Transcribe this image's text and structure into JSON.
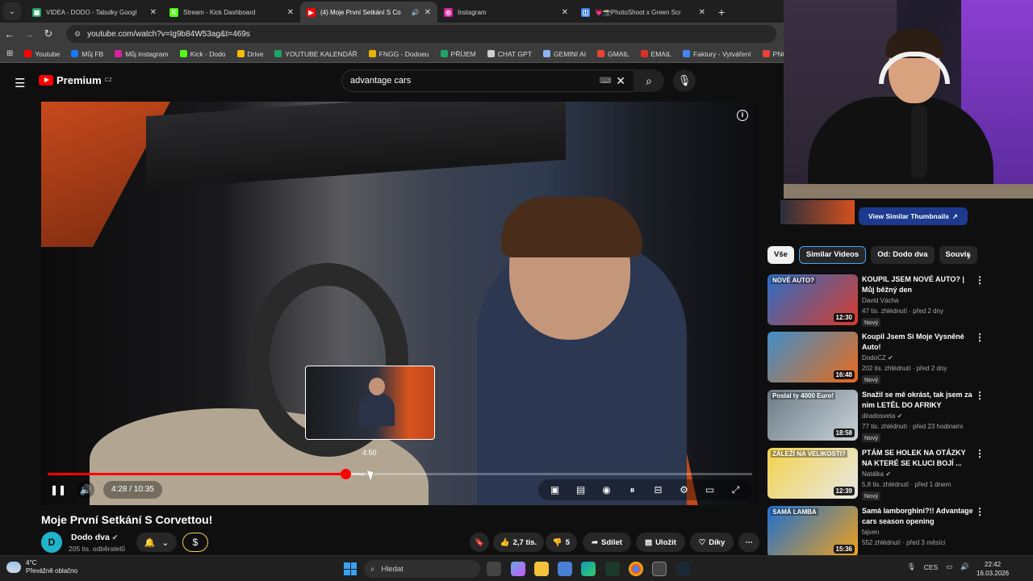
{
  "browser": {
    "tabs": [
      {
        "title": "VIDEA - DODO - Tabulky Googl",
        "fav_color": "#1fa463",
        "fav_glyph": "▦",
        "active": false,
        "audio": false
      },
      {
        "title": "Stream - Kick Dashboard",
        "fav_color": "#53fc18",
        "fav_glyph": "K",
        "active": false,
        "audio": false
      },
      {
        "title": "(4) Moje První Setkání S Co",
        "fav_color": "#ff0000",
        "fav_glyph": "▶",
        "active": true,
        "audio": true
      },
      {
        "title": "Instagram",
        "fav_color": "#d6249f",
        "fav_glyph": "◎",
        "active": false,
        "audio": false
      },
      {
        "title": "💗📸PhotoShoot x Green Scr",
        "fav_color": "#4285f4",
        "fav_glyph": "◫",
        "active": false,
        "audio": false
      }
    ],
    "new_tab": "+",
    "url": "youtube.com/watch?v=Ig9b84W53ag&t=469s",
    "bookmarks": [
      {
        "label": "Youtube",
        "color": "#ff0000"
      },
      {
        "label": "Můj FB",
        "color": "#1877f2"
      },
      {
        "label": "Můj instagram",
        "color": "#d6249f"
      },
      {
        "label": "Kick - Dodo",
        "color": "#53fc18"
      },
      {
        "label": "Drive",
        "color": "#fbbc04"
      },
      {
        "label": "YOUTUBE KALENDÁŘ",
        "color": "#1fa463"
      },
      {
        "label": "FNGG - Dodoeu",
        "color": "#e8b100"
      },
      {
        "label": "PŘÍJEM",
        "color": "#1fa463"
      },
      {
        "label": "CHAT GPT",
        "color": "#cccccc"
      },
      {
        "label": "GEMINI AI",
        "color": "#8ab4f8"
      },
      {
        "label": "GMAIL",
        "color": "#ea4335"
      },
      {
        "label": "EMAIL",
        "color": "#d93025"
      },
      {
        "label": "Faktury - Vytváření",
        "color": "#4285f4"
      },
      {
        "label": "PNG to PDF",
        "color": "#e94235"
      },
      {
        "label": "S",
        "color": "#444444"
      }
    ]
  },
  "youtube": {
    "logo_text": "Premium",
    "logo_region": "CZ",
    "search_value": "advantage cars",
    "video": {
      "title": "Moje První Setkání S Corvettou!",
      "current_time": "4:28",
      "duration": "10:35",
      "time_display": "4:28 / 10:35",
      "played_fraction": 0.423,
      "buffered_fraction": 0.45,
      "preview_time": "4:50"
    },
    "channel": {
      "name": "Dodo dva",
      "subscribers": "205 tis. odběratelů",
      "avatar_glyph": "D"
    },
    "actions": {
      "likes": "2,7 tis.",
      "dislikes": "5",
      "share": "Sdílet",
      "save": "Uložit",
      "thanks": "Díky"
    },
    "view_similar": "View Similar Thumbnails",
    "chips": [
      "Vše",
      "Similar Videos",
      "Od: Dodo dva",
      "Souvis"
    ],
    "recommendations": [
      {
        "title": "KOUPIL JSEM NOVÉ AUTO? | Můj běžný den",
        "channel": "David Vácha",
        "verified": false,
        "meta": "47 tis. zhlédnutí · před 2 dny",
        "badge": "Nový",
        "duration": "12:30",
        "thumb_text": "NOVÉ AUTO?",
        "colors": [
          "#2a6fc7",
          "#d83a2a"
        ]
      },
      {
        "title": "Koupil Jsem Si Moje Vysněné Auto!",
        "channel": "DodoCZ",
        "verified": true,
        "meta": "202 tis. zhlédnutí · před 2 dny",
        "badge": "Nový",
        "duration": "16:48",
        "thumb_text": "",
        "colors": [
          "#3f8fc9",
          "#e86a1a"
        ]
      },
      {
        "title": "Snažil se mě okrást, tak jsem za ním LETĚL DO AFRIKY",
        "channel": "diradosveta",
        "verified": true,
        "meta": "77 tis. zhlédnutí · před 23 hodinami",
        "badge": "Nový",
        "duration": "18:58",
        "thumb_text": "Poslal ty 4000 Euro!",
        "colors": [
          "#6a7a86",
          "#c9d2d8"
        ]
      },
      {
        "title": "PTÁM SE HOLEK NA OTÁZKY NA KTERÉ SE KLUCI BOJÍ ...",
        "channel": "Natálka",
        "verified": true,
        "meta": "5,8 tis. zhlédnutí · před 1 dnem",
        "badge": "Nový",
        "duration": "12:39",
        "thumb_text": "ZÁLEŽÍ NA VELIKOSTI?",
        "colors": [
          "#f3d24a",
          "#e8e8e8"
        ]
      },
      {
        "title": "Samá lamborghini?!! Advantage cars season opening",
        "channel": "fajven",
        "verified": false,
        "meta": "552 zhlédnutí · před 3 měsíci",
        "badge": "",
        "duration": "15:36",
        "thumb_text": "SAMÁ LAMBA",
        "colors": [
          "#1d6fd1",
          "#f0a21a"
        ]
      }
    ]
  },
  "taskbar": {
    "temperature": "4°C",
    "weather": "Převážně oblačno",
    "search_placeholder": "Hledat",
    "language": "CES",
    "time": "22:42",
    "date": "16.03.2026"
  }
}
